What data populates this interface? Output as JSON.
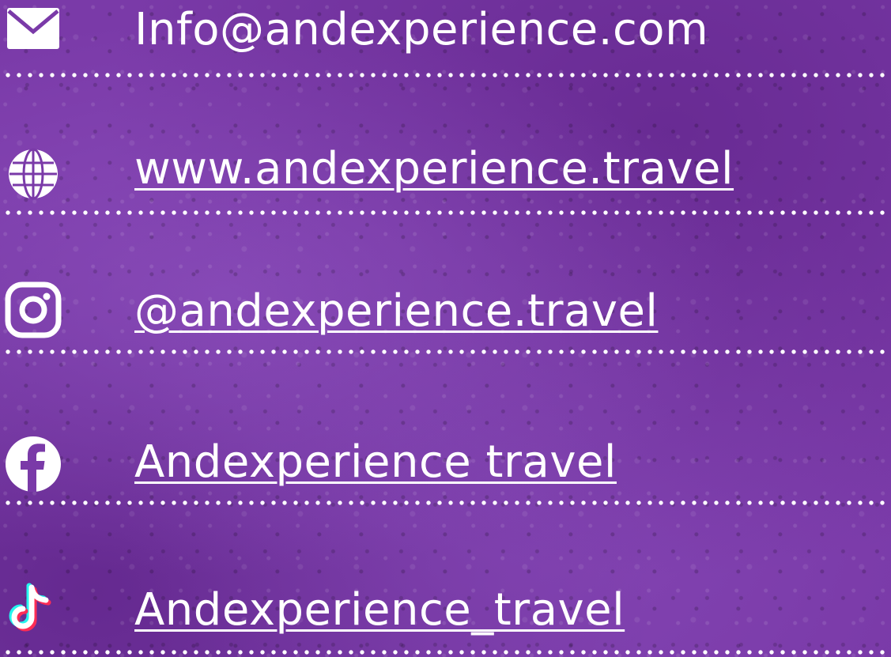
{
  "contacts": [
    {
      "kind": "email",
      "icon": "mail-icon",
      "text": "Info@andexperience.com"
    },
    {
      "kind": "website",
      "icon": "globe-icon",
      "text": "www.andexperience.travel"
    },
    {
      "kind": "instagram",
      "icon": "instagram-icon",
      "text": "@andexperience.travel"
    },
    {
      "kind": "facebook",
      "icon": "facebook-icon",
      "text": "Andexperience travel "
    },
    {
      "kind": "tiktok",
      "icon": "tiktok-icon",
      "text": "Andexperience_travel"
    }
  ],
  "colors": {
    "background": "#7a3aa8",
    "text": "#ffffff",
    "tiktok_cyan": "#25f4ee",
    "tiktok_red": "#fe2c55"
  }
}
